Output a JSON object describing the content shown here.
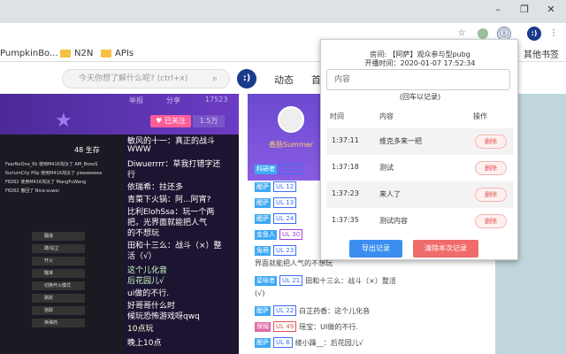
{
  "browser": {
    "bookmarks": [
      "PumpkinBo...",
      "N2N",
      "APIs",
      "其他书签"
    ],
    "ext_avatar": ":)"
  },
  "site": {
    "search_placeholder": "今天你想了解什么呢? (ctrl+x)",
    "avatar": ":)",
    "nav": [
      "动态",
      "首"
    ]
  },
  "stream": {
    "stats": [
      "举报",
      "分享",
      "17523"
    ],
    "follow": "已关注",
    "follow_count": "1.5万",
    "game_info": "48 生存",
    "feed": [
      "FearNoOne_6k 使用M416淘汰了 AM_BoooS",
      "KuriumCity P0p 使用M416淘汰了 yieeeeeeee",
      "F8262 使用M416淘汰了 MangFuWang",
      "F8262 撤回了 Nice-suwei"
    ],
    "menu": [
      "翻滚",
      "蹲/站立",
      "开火",
      "瞄准",
      "切换开火模式",
      "跳跃",
      "拾取",
      "换弹药"
    ],
    "danmaku": [
      "敏风的十一：真正的战斗",
      "WWW",
      "Diwuerrrr：草我打错字还",
      "行",
      "依瑞希：拄还多",
      "青菜下火锅：阿...阿宵?",
      "比利ElohSsa：玩一个两",
      "把，光界面就能把人气",
      "的不想玩",
      "田和十三么：战斗（×）整",
      "活（√）",
      "这个儿化音",
      "后花园儿√",
      "ui做的不行.",
      "好哥哥什么时",
      "候玩恐怖游戏呀qwq",
      "10点玩",
      "晚上10点"
    ]
  },
  "chat": {
    "streamer": "香肠Summer",
    "rows": [
      {
        "tag": "科研者",
        "level": "UL 21",
        "text": ""
      },
      {
        "tag": "醒萨",
        "level": "UL 12",
        "text": ""
      },
      {
        "tag": "醒萨",
        "level": "UL 13",
        "text": ""
      },
      {
        "tag": "醒萨",
        "level": "UL 24",
        "text": ""
      },
      {
        "tag": "金鱼人",
        "level": "UL 30",
        "text": ""
      },
      {
        "tag": "兔萌",
        "level": "UL 23",
        "text": ""
      },
      {
        "tag": "",
        "level": "",
        "text": "界面就能把人气的不想玩"
      },
      {
        "tag": "星咏者",
        "level": "UL 21",
        "text": "田和十三么：战斗（×）整活"
      },
      {
        "tag": "",
        "level": "",
        "text": "(√)"
      },
      {
        "tag": "醒萨",
        "level": "UL 22",
        "text": "白芷药香：这个儿化音"
      },
      {
        "tag": "保姆",
        "level": "UL 49",
        "text": "瑶宝：UI做的不行."
      },
      {
        "tag": "醒萨",
        "level": "UL 6",
        "text": "绫小躁__：后花园儿√"
      }
    ]
  },
  "popup": {
    "title": "房间: 【阿萨】观众参与型pubg",
    "start_time": "开播时间：2020-01-07 17:52:34",
    "input_placeholder": "内容",
    "hint": "(回车以记录)",
    "headers": {
      "time": "时间",
      "content": "内容",
      "action": "操作"
    },
    "records": [
      {
        "time": "1:37:11",
        "content": "维克多来一把",
        "action": "删除"
      },
      {
        "time": "1:37:18",
        "content": "测试",
        "action": "删除"
      },
      {
        "time": "1:37:23",
        "content": "来人了",
        "action": "删除"
      },
      {
        "time": "1:37:35",
        "content": "测试内容",
        "action": "删除"
      }
    ],
    "export_label": "导出记录",
    "clear_label": "清除本次记录"
  }
}
